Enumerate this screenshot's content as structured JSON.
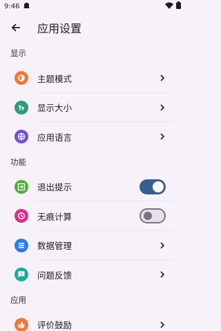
{
  "status": {
    "time": "9:46"
  },
  "header": {
    "title": "应用设置"
  },
  "sections": [
    {
      "title": "显示",
      "items": [
        {
          "label": "主题模式",
          "icon": "theme-icon",
          "color": "#f0783c",
          "type": "nav"
        },
        {
          "label": "显示大小",
          "icon": "text-size-icon",
          "color": "#2e9a7e",
          "type": "nav"
        },
        {
          "label": "应用语言",
          "icon": "globe-icon",
          "color": "#7b4fd0",
          "type": "nav"
        }
      ]
    },
    {
      "title": "功能",
      "items": [
        {
          "label": "退出提示",
          "icon": "exit-icon",
          "color": "#4caf3a",
          "type": "toggle",
          "on": true
        },
        {
          "label": "无痕计算",
          "icon": "history-icon",
          "color": "#d6328a",
          "type": "toggle",
          "on": false
        },
        {
          "label": "数据管理",
          "icon": "list-icon",
          "color": "#2f7de0",
          "type": "nav"
        },
        {
          "label": "问题反馈",
          "icon": "feedback-icon",
          "color": "#20a99a",
          "type": "nav"
        }
      ]
    },
    {
      "title": "应用",
      "items": [
        {
          "label": "评价鼓励",
          "icon": "thumb-up-icon",
          "color": "#f0783c",
          "type": "nav"
        }
      ]
    }
  ]
}
